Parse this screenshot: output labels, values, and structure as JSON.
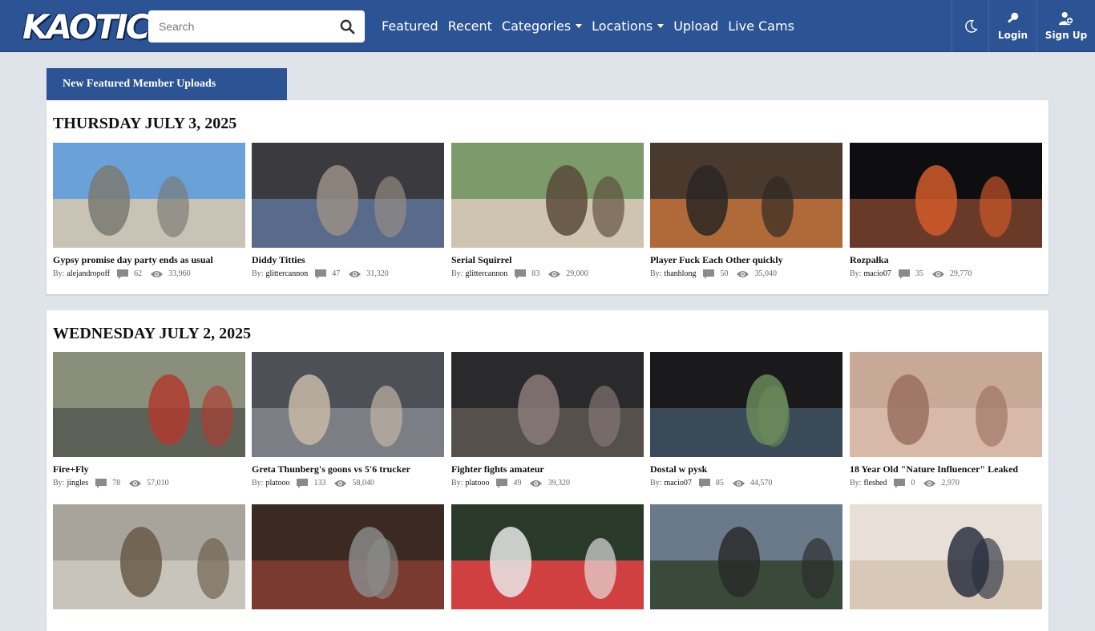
{
  "header": {
    "logo": "KAOTIC",
    "search_placeholder": "Search",
    "nav": [
      {
        "label": "Featured",
        "dropdown": false
      },
      {
        "label": "Recent",
        "dropdown": false
      },
      {
        "label": "Categories",
        "dropdown": true
      },
      {
        "label": "Locations",
        "dropdown": true
      },
      {
        "label": "Upload",
        "dropdown": false
      },
      {
        "label": "Live Cams",
        "dropdown": false
      }
    ],
    "login_label": "Login",
    "signup_label": "Sign Up"
  },
  "section_tab": "New Featured Member Uploads",
  "by_label": "By:",
  "days": [
    {
      "title": "THURSDAY JULY 3, 2025",
      "videos": [
        {
          "title": "Gypsy promise day party ends as usual",
          "user": "alejandropoff",
          "comments": "62",
          "views": "33,960"
        },
        {
          "title": "Diddy Titties",
          "user": "glittercannon",
          "comments": "47",
          "views": "31,320"
        },
        {
          "title": "Serial Squirrel",
          "user": "glittercannon",
          "comments": "83",
          "views": "29,000"
        },
        {
          "title": "Player Fuck Each Other quickly",
          "user": "thanhlong",
          "comments": "50",
          "views": "35,040"
        },
        {
          "title": "Rozpałka",
          "user": "macio07",
          "comments": "35",
          "views": "29,770"
        }
      ]
    },
    {
      "title": "WEDNESDAY JULY 2, 2025",
      "videos": [
        {
          "title": "Fire+Fly",
          "user": "jingles",
          "comments": "78",
          "views": "57,010"
        },
        {
          "title": "Greta Thunberg's goons vs 5'6 trucker",
          "user": "platooo",
          "comments": "133",
          "views": "58,040"
        },
        {
          "title": "Fighter fights amateur",
          "user": "platooo",
          "comments": "49",
          "views": "39,320"
        },
        {
          "title": "Dostal w pysk",
          "user": "macio07",
          "comments": "85",
          "views": "44,570"
        },
        {
          "title": "18 Year Old \"Nature Influencer\" Leaked",
          "user": "fleshed",
          "comments": "0",
          "views": "2,970"
        }
      ]
    }
  ],
  "colors": {
    "header_bg": "#2c5494",
    "page_bg": "#dfe3ea",
    "panel_bg": "#ffffff",
    "icon_gray": "#888888"
  }
}
